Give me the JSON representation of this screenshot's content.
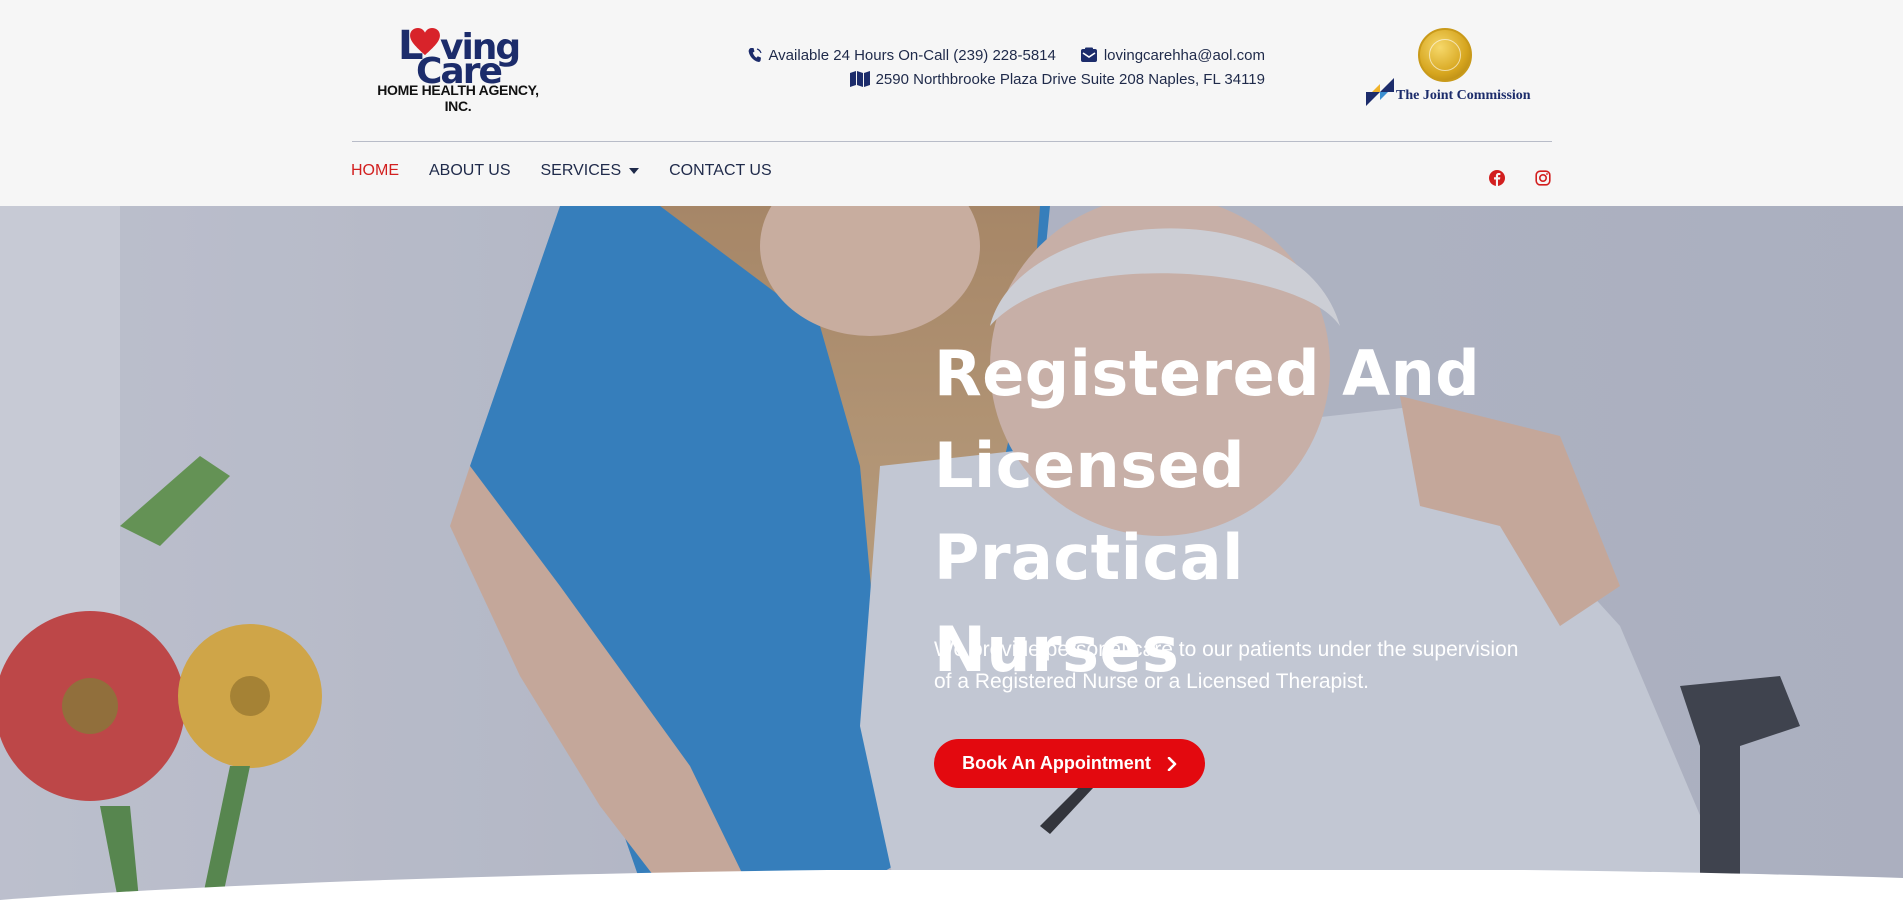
{
  "logo": {
    "letter_l": "L",
    "letters_ving": "ving",
    "word_care": "Care",
    "subtitle": "HOME HEALTH AGENCY, INC."
  },
  "contact": {
    "phone": "Available 24 Hours On-Call (239) 228-5814",
    "email": "lovingcarehha@aol.com",
    "address": "2590 Northbrooke Plaza Drive Suite 208 Naples, FL 34119"
  },
  "accreditation": {
    "name": "The Joint Commission"
  },
  "nav": {
    "items": [
      {
        "label": "HOME",
        "active": true
      },
      {
        "label": "ABOUT US",
        "active": false
      },
      {
        "label": "SERVICES",
        "active": false,
        "has_dropdown": true
      },
      {
        "label": "CONTACT US",
        "active": false
      }
    ]
  },
  "social": [
    {
      "icon": "facebook-icon"
    },
    {
      "icon": "instagram-icon"
    }
  ],
  "hero": {
    "title_line1": "Registered And",
    "title_line2": "Licensed Practical",
    "title_line3": "Nurses",
    "text_line1": "We provide personal care to our patients under the supervision",
    "text_line2": "of a Registered Nurse or a Licensed Therapist.",
    "button_label": "Book An Appointment"
  },
  "colors": {
    "brand_navy": "#1c2c6b",
    "accent_red": "#e3090f",
    "nav_active": "#d21f1f",
    "header_bg": "#f6f6f6"
  }
}
